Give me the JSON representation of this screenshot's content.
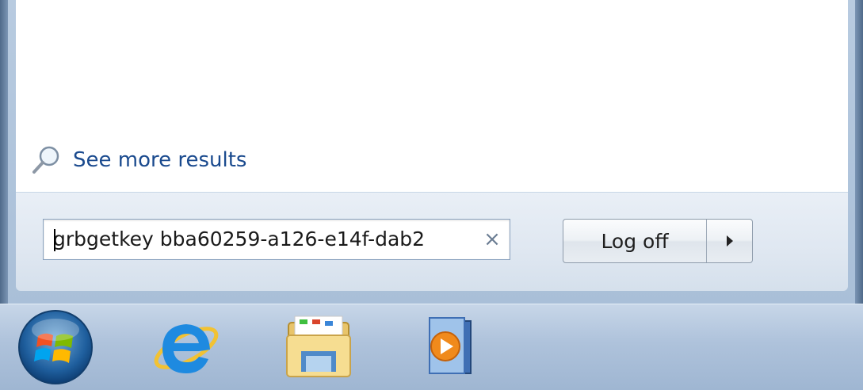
{
  "start_menu": {
    "see_more_results": "See more results",
    "search": {
      "value": "grbgetkey bba60259-a126-e14f-dab2",
      "clear_glyph": "×"
    },
    "power": {
      "logoff_label": "Log off",
      "arrow_icon": "triangle-right-icon"
    }
  },
  "taskbar": {
    "items": [
      {
        "icon": "windows-start-orb-icon"
      },
      {
        "icon": "internet-explorer-icon"
      },
      {
        "icon": "windows-explorer-folder-icon"
      },
      {
        "icon": "windows-media-player-icon"
      }
    ]
  },
  "colors": {
    "link": "#1a4a8e",
    "taskbar": "#aec2db",
    "frame": "#a9bfd8"
  }
}
